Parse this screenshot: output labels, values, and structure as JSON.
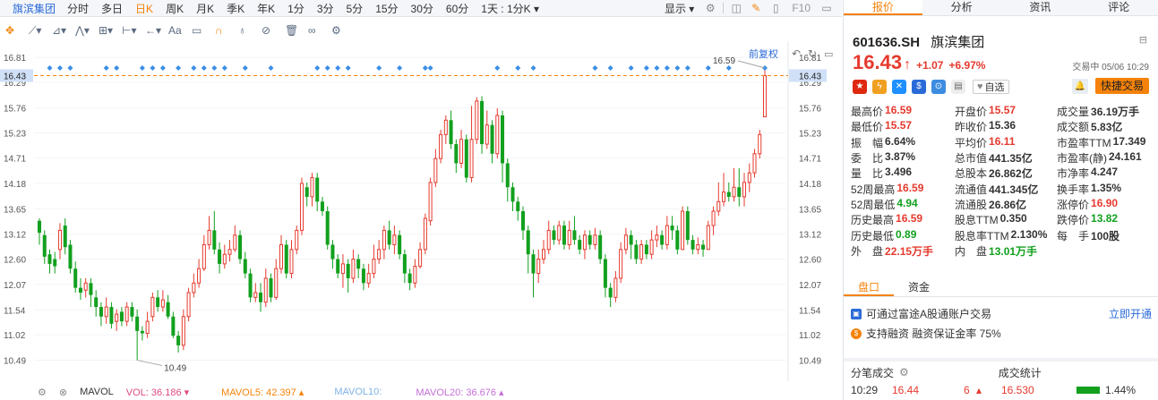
{
  "topbar": {
    "stock_name": "旗滨集团",
    "periods": [
      "分时",
      "多日",
      "日K",
      "周K",
      "月K",
      "季K",
      "年K",
      "1分",
      "3分",
      "5分",
      "15分",
      "30分",
      "60分",
      "1天 : 1分K ▾"
    ],
    "active_period": "日K",
    "display_label": "显示 ▾",
    "f10_label": "F10"
  },
  "toolbar": {
    "text_tool": "Aa"
  },
  "chart": {
    "fq_label": "前复权",
    "max_label": "16.59",
    "min_label": "10.49",
    "current_price_tag": "16.43",
    "axis_ticks": [
      "16.81",
      "16.29",
      "15.76",
      "15.23",
      "14.71",
      "14.18",
      "13.65",
      "13.12",
      "12.60",
      "12.07",
      "11.54",
      "11.02",
      "10.49"
    ]
  },
  "chart_data": {
    "type": "candlestick",
    "ylim": [
      10.2,
      17.0
    ],
    "reference_price": 16.43,
    "candles": [
      {
        "o": 13.4,
        "c": 13.15,
        "h": 13.45,
        "l": 12.9
      },
      {
        "o": 13.1,
        "c": 12.65,
        "h": 13.2,
        "l": 12.5
      },
      {
        "o": 12.7,
        "c": 12.5,
        "h": 12.8,
        "l": 12.3
      },
      {
        "o": 12.6,
        "c": 12.45,
        "h": 12.75,
        "l": 12.3
      },
      {
        "o": 12.8,
        "c": 13.2,
        "h": 13.35,
        "l": 12.6
      },
      {
        "o": 13.3,
        "c": 12.85,
        "h": 13.45,
        "l": 12.7
      },
      {
        "o": 12.9,
        "c": 12.4,
        "h": 13.0,
        "l": 12.3
      },
      {
        "o": 12.4,
        "c": 12.0,
        "h": 12.55,
        "l": 11.9
      },
      {
        "o": 12.0,
        "c": 11.9,
        "h": 12.2,
        "l": 11.75
      },
      {
        "o": 11.95,
        "c": 12.1,
        "h": 12.2,
        "l": 11.8
      },
      {
        "o": 12.1,
        "c": 11.85,
        "h": 12.2,
        "l": 11.6
      },
      {
        "o": 11.8,
        "c": 11.6,
        "h": 11.95,
        "l": 11.4
      },
      {
        "o": 11.6,
        "c": 11.4,
        "h": 11.7,
        "l": 11.2
      },
      {
        "o": 11.4,
        "c": 11.6,
        "h": 11.8,
        "l": 11.25
      },
      {
        "o": 11.6,
        "c": 11.25,
        "h": 11.7,
        "l": 11.15
      },
      {
        "o": 11.3,
        "c": 11.45,
        "h": 11.55,
        "l": 11.1
      },
      {
        "o": 11.5,
        "c": 11.3,
        "h": 11.6,
        "l": 11.2
      },
      {
        "o": 11.3,
        "c": 11.6,
        "h": 11.7,
        "l": 11.2
      },
      {
        "o": 11.6,
        "c": 11.4,
        "h": 11.7,
        "l": 11.3
      },
      {
        "o": 11.4,
        "c": 11.1,
        "h": 11.55,
        "l": 10.49
      },
      {
        "o": 11.1,
        "c": 11.05,
        "h": 11.2,
        "l": 10.9
      },
      {
        "o": 11.05,
        "c": 11.3,
        "h": 11.5,
        "l": 10.95
      },
      {
        "o": 11.4,
        "c": 11.8,
        "h": 11.9,
        "l": 11.3
      },
      {
        "o": 11.8,
        "c": 11.6,
        "h": 11.95,
        "l": 11.5
      },
      {
        "o": 11.6,
        "c": 11.75,
        "h": 11.95,
        "l": 11.5
      },
      {
        "o": 11.7,
        "c": 11.4,
        "h": 11.85,
        "l": 11.35
      },
      {
        "o": 11.4,
        "c": 11.0,
        "h": 11.5,
        "l": 10.95
      },
      {
        "o": 11.0,
        "c": 10.8,
        "h": 11.1,
        "l": 10.65
      },
      {
        "o": 10.8,
        "c": 11.4,
        "h": 11.55,
        "l": 10.7
      },
      {
        "o": 11.4,
        "c": 11.9,
        "h": 12.0,
        "l": 11.3
      },
      {
        "o": 11.9,
        "c": 12.1,
        "h": 12.3,
        "l": 11.8
      },
      {
        "o": 12.1,
        "c": 12.4,
        "h": 12.6,
        "l": 12.0
      },
      {
        "o": 12.4,
        "c": 12.9,
        "h": 13.1,
        "l": 12.35
      },
      {
        "o": 12.9,
        "c": 13.2,
        "h": 13.5,
        "l": 12.8
      },
      {
        "o": 13.2,
        "c": 12.8,
        "h": 13.6,
        "l": 12.7
      },
      {
        "o": 12.8,
        "c": 12.5,
        "h": 12.95,
        "l": 12.3
      },
      {
        "o": 12.5,
        "c": 12.7,
        "h": 12.9,
        "l": 12.4
      },
      {
        "o": 12.7,
        "c": 12.8,
        "h": 13.0,
        "l": 12.55
      },
      {
        "o": 12.8,
        "c": 13.1,
        "h": 13.3,
        "l": 12.75
      },
      {
        "o": 13.1,
        "c": 12.6,
        "h": 13.2,
        "l": 12.5
      },
      {
        "o": 12.6,
        "c": 12.3,
        "h": 12.75,
        "l": 12.2
      },
      {
        "o": 12.3,
        "c": 11.8,
        "h": 12.4,
        "l": 11.7
      },
      {
        "o": 11.8,
        "c": 11.9,
        "h": 12.1,
        "l": 11.7
      },
      {
        "o": 11.9,
        "c": 11.7,
        "h": 12.1,
        "l": 11.5
      },
      {
        "o": 11.7,
        "c": 12.2,
        "h": 12.4,
        "l": 11.6
      },
      {
        "o": 12.2,
        "c": 11.8,
        "h": 12.3,
        "l": 11.7
      },
      {
        "o": 11.8,
        "c": 12.4,
        "h": 12.6,
        "l": 11.75
      },
      {
        "o": 12.4,
        "c": 12.9,
        "h": 13.1,
        "l": 12.3
      },
      {
        "o": 12.9,
        "c": 12.3,
        "h": 13.0,
        "l": 12.2
      },
      {
        "o": 12.3,
        "c": 12.8,
        "h": 13.0,
        "l": 12.2
      },
      {
        "o": 12.8,
        "c": 13.2,
        "h": 13.3,
        "l": 12.7
      },
      {
        "o": 13.2,
        "c": 14.18,
        "h": 14.3,
        "l": 13.1
      },
      {
        "o": 14.1,
        "c": 13.9,
        "h": 14.2,
        "l": 13.7
      },
      {
        "o": 13.9,
        "c": 14.3,
        "h": 14.4,
        "l": 13.7
      },
      {
        "o": 14.3,
        "c": 13.8,
        "h": 14.4,
        "l": 13.6
      },
      {
        "o": 13.8,
        "c": 13.6,
        "h": 13.9,
        "l": 13.5
      },
      {
        "o": 13.6,
        "c": 12.9,
        "h": 13.7,
        "l": 12.8
      },
      {
        "o": 12.9,
        "c": 12.6,
        "h": 13.0,
        "l": 12.4
      },
      {
        "o": 12.6,
        "c": 12.3,
        "h": 12.7,
        "l": 12.2
      },
      {
        "o": 12.3,
        "c": 12.5,
        "h": 12.7,
        "l": 12.0
      },
      {
        "o": 12.5,
        "c": 12.2,
        "h": 12.6,
        "l": 11.9
      },
      {
        "o": 12.2,
        "c": 12.6,
        "h": 12.8,
        "l": 12.1
      },
      {
        "o": 12.6,
        "c": 12.4,
        "h": 12.7,
        "l": 12.2
      },
      {
        "o": 12.4,
        "c": 12.1,
        "h": 12.5,
        "l": 11.95
      },
      {
        "o": 12.1,
        "c": 12.3,
        "h": 12.5,
        "l": 12.0
      },
      {
        "o": 12.3,
        "c": 12.6,
        "h": 12.9,
        "l": 12.2
      },
      {
        "o": 12.6,
        "c": 12.8,
        "h": 13.0,
        "l": 12.5
      },
      {
        "o": 12.8,
        "c": 13.2,
        "h": 13.3,
        "l": 12.6
      },
      {
        "o": 13.2,
        "c": 12.9,
        "h": 13.4,
        "l": 12.8
      },
      {
        "o": 12.9,
        "c": 13.1,
        "h": 13.3,
        "l": 12.7
      },
      {
        "o": 13.1,
        "c": 12.7,
        "h": 13.2,
        "l": 12.6
      },
      {
        "o": 12.7,
        "c": 12.3,
        "h": 12.8,
        "l": 12.1
      },
      {
        "o": 12.3,
        "c": 12.1,
        "h": 12.4,
        "l": 11.95
      },
      {
        "o": 12.1,
        "c": 12.45,
        "h": 12.6,
        "l": 12.0
      },
      {
        "o": 12.45,
        "c": 12.8,
        "h": 12.95,
        "l": 12.4
      },
      {
        "o": 12.8,
        "c": 13.45,
        "h": 13.55,
        "l": 12.7
      },
      {
        "o": 13.4,
        "c": 14.2,
        "h": 14.3,
        "l": 13.3
      },
      {
        "o": 14.2,
        "c": 14.7,
        "h": 14.9,
        "l": 14.1
      },
      {
        "o": 14.7,
        "c": 15.2,
        "h": 15.3,
        "l": 14.6
      },
      {
        "o": 15.2,
        "c": 15.5,
        "h": 15.6,
        "l": 15.0
      },
      {
        "o": 15.5,
        "c": 15.0,
        "h": 15.7,
        "l": 14.9
      },
      {
        "o": 15.0,
        "c": 14.6,
        "h": 15.1,
        "l": 14.4
      },
      {
        "o": 14.6,
        "c": 15.1,
        "h": 15.3,
        "l": 14.5
      },
      {
        "o": 15.1,
        "c": 14.3,
        "h": 15.2,
        "l": 14.2
      },
      {
        "o": 14.3,
        "c": 15.1,
        "h": 15.8,
        "l": 14.2
      },
      {
        "o": 15.1,
        "c": 15.9,
        "h": 15.98,
        "l": 15.0
      },
      {
        "o": 15.9,
        "c": 15.0,
        "h": 16.0,
        "l": 14.8
      },
      {
        "o": 15.0,
        "c": 15.4,
        "h": 15.7,
        "l": 14.9
      },
      {
        "o": 15.4,
        "c": 14.8,
        "h": 15.5,
        "l": 14.6
      },
      {
        "o": 14.8,
        "c": 15.6,
        "h": 15.75,
        "l": 14.7
      },
      {
        "o": 15.6,
        "c": 14.6,
        "h": 15.7,
        "l": 14.2
      },
      {
        "o": 14.6,
        "c": 14.1,
        "h": 14.7,
        "l": 13.8
      },
      {
        "o": 14.1,
        "c": 13.8,
        "h": 14.2,
        "l": 13.6
      },
      {
        "o": 13.8,
        "c": 13.6,
        "h": 13.9,
        "l": 13.4
      },
      {
        "o": 13.6,
        "c": 13.2,
        "h": 13.7,
        "l": 13.0
      },
      {
        "o": 13.2,
        "c": 12.7,
        "h": 13.3,
        "l": 12.3
      },
      {
        "o": 12.7,
        "c": 12.3,
        "h": 12.8,
        "l": 11.8
      },
      {
        "o": 12.3,
        "c": 12.6,
        "h": 12.8,
        "l": 12.1
      },
      {
        "o": 12.6,
        "c": 12.8,
        "h": 13.0,
        "l": 12.5
      },
      {
        "o": 12.8,
        "c": 13.2,
        "h": 13.4,
        "l": 12.7
      },
      {
        "o": 13.2,
        "c": 13.0,
        "h": 13.3,
        "l": 12.9
      },
      {
        "o": 13.0,
        "c": 13.3,
        "h": 13.4,
        "l": 12.9
      },
      {
        "o": 13.3,
        "c": 12.9,
        "h": 13.4,
        "l": 12.8
      },
      {
        "o": 12.9,
        "c": 13.2,
        "h": 13.4,
        "l": 12.8
      },
      {
        "o": 13.2,
        "c": 13.0,
        "h": 13.5,
        "l": 12.9
      },
      {
        "o": 13.0,
        "c": 12.8,
        "h": 13.1,
        "l": 12.7
      },
      {
        "o": 12.8,
        "c": 13.1,
        "h": 13.2,
        "l": 12.6
      },
      {
        "o": 13.1,
        "c": 12.9,
        "h": 13.2,
        "l": 12.8
      },
      {
        "o": 12.9,
        "c": 13.1,
        "h": 13.25,
        "l": 12.8
      },
      {
        "o": 13.1,
        "c": 12.6,
        "h": 13.2,
        "l": 12.5
      },
      {
        "o": 12.6,
        "c": 12.0,
        "h": 12.7,
        "l": 11.8
      },
      {
        "o": 12.0,
        "c": 11.8,
        "h": 12.1,
        "l": 11.6
      },
      {
        "o": 11.8,
        "c": 12.2,
        "h": 12.35,
        "l": 11.7
      },
      {
        "o": 12.2,
        "c": 12.8,
        "h": 12.95,
        "l": 12.1
      },
      {
        "o": 12.8,
        "c": 13.1,
        "h": 13.25,
        "l": 12.7
      },
      {
        "o": 13.1,
        "c": 12.9,
        "h": 13.2,
        "l": 12.6
      },
      {
        "o": 12.9,
        "c": 12.6,
        "h": 13.0,
        "l": 12.5
      },
      {
        "o": 12.6,
        "c": 12.9,
        "h": 13.0,
        "l": 12.5
      },
      {
        "o": 12.9,
        "c": 12.7,
        "h": 13.0,
        "l": 12.6
      },
      {
        "o": 12.7,
        "c": 13.0,
        "h": 13.2,
        "l": 12.6
      },
      {
        "o": 13.0,
        "c": 13.1,
        "h": 13.3,
        "l": 12.85
      },
      {
        "o": 13.1,
        "c": 12.9,
        "h": 13.2,
        "l": 12.8
      },
      {
        "o": 12.9,
        "c": 13.3,
        "h": 13.5,
        "l": 12.8
      },
      {
        "o": 13.3,
        "c": 13.2,
        "h": 13.5,
        "l": 13.0
      },
      {
        "o": 13.2,
        "c": 12.8,
        "h": 13.3,
        "l": 12.7
      },
      {
        "o": 12.8,
        "c": 13.6,
        "h": 13.7,
        "l": 12.8
      },
      {
        "o": 13.6,
        "c": 13.0,
        "h": 13.7,
        "l": 12.9
      },
      {
        "o": 13.0,
        "c": 12.8,
        "h": 13.1,
        "l": 12.7
      },
      {
        "o": 12.8,
        "c": 12.9,
        "h": 13.05,
        "l": 12.7
      },
      {
        "o": 12.9,
        "c": 12.8,
        "h": 13.0,
        "l": 12.65
      },
      {
        "o": 12.8,
        "c": 13.3,
        "h": 13.4,
        "l": 12.8
      },
      {
        "o": 13.3,
        "c": 13.6,
        "h": 13.7,
        "l": 13.1
      },
      {
        "o": 13.6,
        "c": 13.8,
        "h": 14.2,
        "l": 13.5
      },
      {
        "o": 13.8,
        "c": 14.0,
        "h": 14.4,
        "l": 13.7
      },
      {
        "o": 14.0,
        "c": 13.9,
        "h": 14.2,
        "l": 13.8
      },
      {
        "o": 13.9,
        "c": 14.1,
        "h": 14.5,
        "l": 13.8
      },
      {
        "o": 14.1,
        "c": 13.9,
        "h": 14.5,
        "l": 13.7
      },
      {
        "o": 13.9,
        "c": 14.2,
        "h": 14.4,
        "l": 13.7
      },
      {
        "o": 14.2,
        "c": 14.4,
        "h": 14.6,
        "l": 14.0
      },
      {
        "o": 14.4,
        "c": 14.8,
        "h": 14.9,
        "l": 14.3
      },
      {
        "o": 14.8,
        "c": 15.2,
        "h": 15.3,
        "l": 14.7
      },
      {
        "o": 15.57,
        "c": 16.43,
        "h": 16.59,
        "l": 15.57
      }
    ]
  },
  "bottombar": {
    "mavol": "MAVOL",
    "vol": "VOL: 36.186 ▾",
    "mavol5": "MAVOL5: 42.397 ▴",
    "mavol10": "MAVOL10:",
    "mavol20": "MAVOL20: 36.676 ▴"
  },
  "tabs": [
    "报价",
    "分析",
    "资讯",
    "评论"
  ],
  "active_tab": "报价",
  "quote": {
    "code": "601636.SH",
    "name": "旗滨集团",
    "price": "16.43",
    "arrow": "↑",
    "change": "+1.07",
    "change_pct": "+6.97%",
    "status": "交易中 05/06 10:29",
    "zixuan": "自选",
    "trade_button": "快捷交易",
    "rows": [
      [
        [
          "最高价",
          "16.59",
          "red"
        ],
        [
          "开盘价",
          "15.57",
          "red"
        ],
        [
          "成交量",
          "36.19万手",
          "blk"
        ]
      ],
      [
        [
          "最低价",
          "15.57",
          "red"
        ],
        [
          "昨收价",
          "15.36",
          "blk"
        ],
        [
          "成交额",
          "5.83亿",
          "blk"
        ]
      ],
      [
        [
          "振　幅",
          "6.64%",
          "blk"
        ],
        [
          "平均价",
          "16.11",
          "red"
        ],
        [
          "市盈率TTM",
          "17.349",
          "blk"
        ]
      ],
      [
        [
          "委　比",
          "3.87%",
          "blk"
        ],
        [
          "总市值",
          "441.35亿",
          "blk"
        ],
        [
          "市盈率(静)",
          "24.161",
          "blk"
        ]
      ],
      [
        [
          "量　比",
          "3.496",
          "blk"
        ],
        [
          "总股本",
          "26.862亿",
          "blk"
        ],
        [
          "市净率",
          "4.247",
          "blk"
        ]
      ],
      [
        [
          "52周最高",
          "16.59",
          "red"
        ],
        [
          "流通值",
          "441.345亿",
          "blk"
        ],
        [
          "换手率",
          "1.35%",
          "blk"
        ]
      ],
      [
        [
          "52周最低",
          "4.94",
          "green"
        ],
        [
          "流通股",
          "26.86亿",
          "blk"
        ],
        [
          "涨停价",
          "16.90",
          "red"
        ]
      ],
      [
        [
          "历史最高",
          "16.59",
          "red"
        ],
        [
          "股息TTM",
          "0.350",
          "blk"
        ],
        [
          "跌停价",
          "13.82",
          "green"
        ]
      ],
      [
        [
          "历史最低",
          "0.89",
          "green"
        ],
        [
          "股息率TTM",
          "2.130%",
          "blk"
        ],
        [
          "每　手",
          "100股",
          "blk"
        ]
      ],
      [
        [
          "外　盘",
          "22.15万手",
          "red"
        ],
        [
          "内　盘",
          "13.01万手",
          "green"
        ],
        [
          "",
          "",
          " "
        ]
      ]
    ]
  },
  "pank_tabs": [
    "盘口",
    "资金"
  ],
  "info1": {
    "text": "可通过富途A股通账户交易",
    "link": "立即开通"
  },
  "info2": {
    "text": "支持融资  融资保证金率 75%"
  },
  "ticks": {
    "title_left": "分笔成交",
    "title_right": "成交统计",
    "row_time": "10:29",
    "row_price": "16.44",
    "row_vol": "6",
    "row_stat_price": "16.530",
    "row_stat_pct": "1.44%"
  }
}
